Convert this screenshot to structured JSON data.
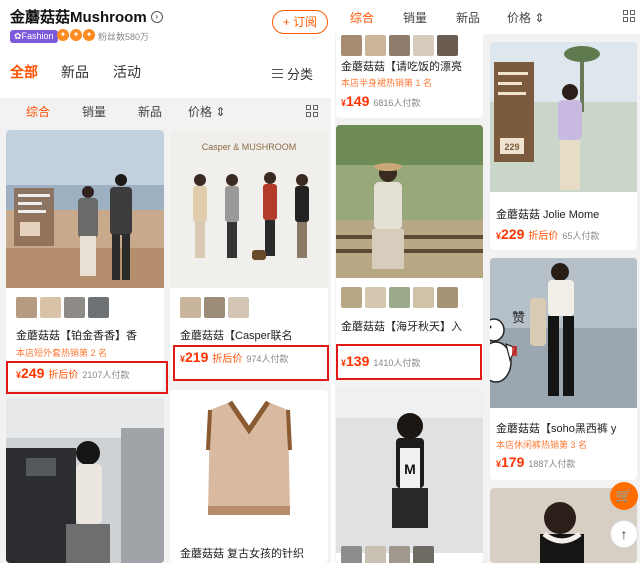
{
  "shop": {
    "name": "金蘑菇菇Mushroom",
    "badge": "Fashion",
    "fans": "粉丝数580万",
    "subscribe": "+ 订阅",
    "arrow": "›"
  },
  "tabs": [
    {
      "label": "全部"
    },
    {
      "label": "新品"
    },
    {
      "label": "活动"
    }
  ],
  "category": "分类",
  "sort": [
    {
      "label": "综合"
    },
    {
      "label": "销量"
    },
    {
      "label": "新品"
    },
    {
      "label": "价格 ⇕"
    }
  ],
  "products_left": [
    {
      "title": "金蘑菇菇【铂金香香】香",
      "rank": "本店短外套热销第 2 名",
      "price": "249",
      "price_label": "折后价",
      "sold": "2107人付款"
    },
    {
      "brand_banner": "Casper & MUSHROOM",
      "title": "金蘑菇菇【Casper联名",
      "price": "219",
      "price_label": "折后价",
      "sold": "974人付款"
    },
    {
      "title": ""
    },
    {
      "title": "金蘑菇菇 复古女孩的针织"
    }
  ],
  "products_right": [
    {
      "title": "金蘑菇菇【请吃饭的漂亮",
      "rank": "本店半身裙热销第 1 名",
      "price": "149",
      "sold": "6816人付款"
    },
    {
      "title": "金蘑菇菇 Jolie Mome",
      "price": "229",
      "price_label": "折后价",
      "sold": "65人付款",
      "tag_price": "229"
    },
    {
      "title": "金蘑菇菇【海牙秋天】入",
      "price": "139",
      "sold": "1410人付款"
    },
    {
      "title": "金蘑菇菇【soho黑西裤 y",
      "rank": "本店休闲裤热销第 3 名",
      "price": "179",
      "sold": "1887人付款",
      "sticker": "赞"
    }
  ],
  "currency": "¥",
  "colors": {
    "accent": "#ff5000",
    "price": "#ff3300",
    "highlight": "#e01818",
    "badge": "#7b5bdb"
  },
  "icons": {
    "cart": "cart-icon",
    "top": "back-to-top-icon",
    "grid": "grid-view-icon",
    "menu": "lines-icon"
  }
}
